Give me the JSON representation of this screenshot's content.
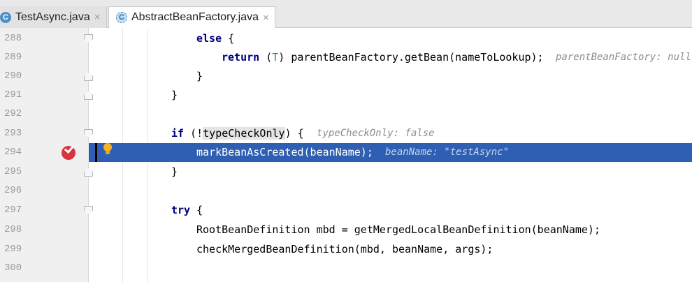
{
  "tabs": [
    {
      "icon": "C",
      "label": "TestAsync.java",
      "close": "×",
      "active": false
    },
    {
      "icon": "C",
      "label": "AbstractBeanFactory.java",
      "close": "×",
      "active": true
    }
  ],
  "colors": {
    "current_line": "#2f5fb3",
    "keyword": "#000080",
    "breakpoint": "#d8343b",
    "gutter": "#f0f0f0"
  },
  "lines": [
    {
      "num": "288",
      "kw": "else",
      "rest": " {"
    },
    {
      "num": "289",
      "kw": "return",
      "paren_open": " (",
      "type": "T",
      "paren_close": ") ",
      "rest": "parentBeanFactory.getBean(nameToLookup);",
      "hint": "parentBeanFactory: null"
    },
    {
      "num": "290",
      "rest": "}"
    },
    {
      "num": "291",
      "rest": "}"
    },
    {
      "num": "292"
    },
    {
      "num": "293",
      "kw": "if",
      "pre": " (!",
      "highlight": "typeCheckOnly",
      "rest": ") {",
      "hint": "typeCheckOnly: false"
    },
    {
      "num": "294",
      "rest": "markBeanAsCreated(beanName);",
      "hint": "beanName: \"testAsync\""
    },
    {
      "num": "295",
      "rest": "}"
    },
    {
      "num": "296"
    },
    {
      "num": "297",
      "kw": "try",
      "rest": " {"
    },
    {
      "num": "298",
      "rest": "RootBeanDefinition mbd = getMergedLocalBeanDefinition(beanName);"
    },
    {
      "num": "299",
      "rest": "checkMergedBeanDefinition(mbd, beanName, args);"
    },
    {
      "num": "300"
    }
  ]
}
